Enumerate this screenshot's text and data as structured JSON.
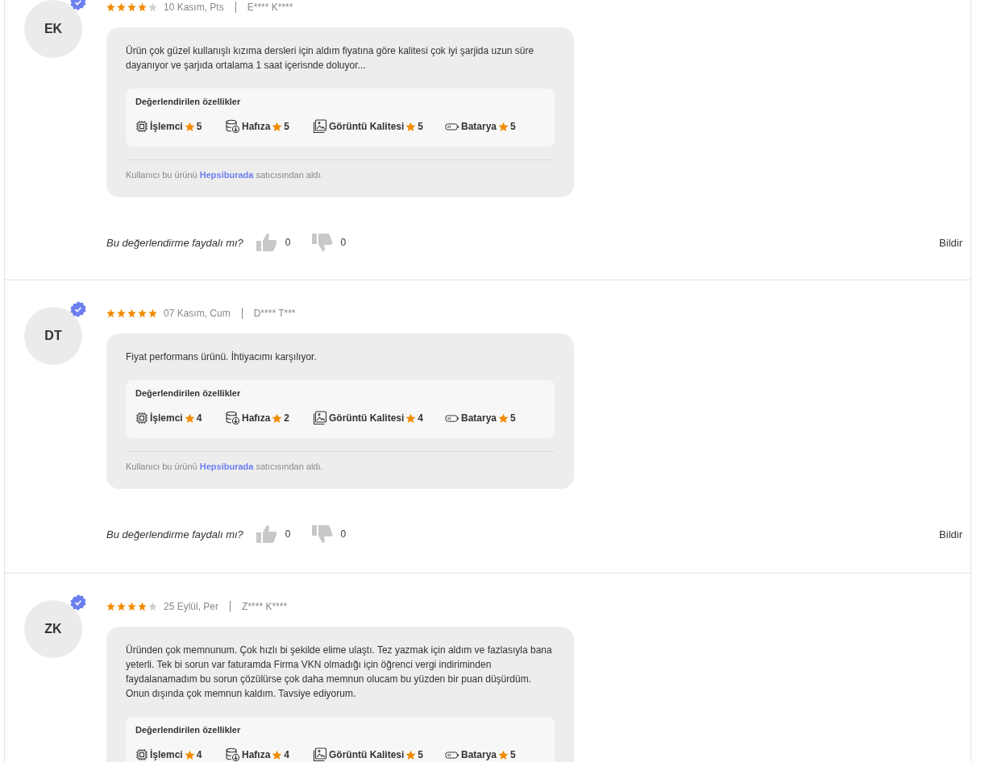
{
  "reviews": [
    {
      "initials": "EK",
      "verified": true,
      "stars": 4,
      "date": "10 Kasım, Pts",
      "author": "E**** K****",
      "text": "Ürün çok güzel kullanışlı kızıma dersleri için aldım fiyatına göre kalitesi çok iyi şarjida uzun süre dayanıyor ve şarjıda ortalama 1 saat içerisnde doluyor...",
      "features_title": "Değerlendirilen özellikler",
      "features": [
        {
          "kind": "processor",
          "name": "İşlemci",
          "rating": "5"
        },
        {
          "kind": "memory",
          "name": "Hafıza",
          "rating": "5"
        },
        {
          "kind": "image",
          "name": "Görüntü Kalitesi",
          "rating": "5"
        },
        {
          "kind": "battery",
          "name": "Batarya",
          "rating": "5"
        }
      ],
      "seller_note": {
        "before": "Kullanıcı bu ürünü",
        "seller": "Hepsiburada",
        "after": "satıcısından aldı."
      },
      "helpful": {
        "question": "Bu değerlendirme faydalı mı?",
        "up_count": "0",
        "down_count": "0",
        "report": "Bildir"
      }
    },
    {
      "initials": "DT",
      "verified": true,
      "stars": 5,
      "date": "07 Kasım, Cum",
      "author": "D**** T***",
      "text": "Fiyat performans ürünü. İhtiyacımı karşılıyor.",
      "features_title": "Değerlendirilen özellikler",
      "features": [
        {
          "kind": "processor",
          "name": "İşlemci",
          "rating": "4"
        },
        {
          "kind": "memory",
          "name": "Hafıza",
          "rating": "2"
        },
        {
          "kind": "image",
          "name": "Görüntü Kalitesi",
          "rating": "4"
        },
        {
          "kind": "battery",
          "name": "Batarya",
          "rating": "5"
        }
      ],
      "seller_note": {
        "before": "Kullanıcı bu ürünü",
        "seller": "Hepsiburada",
        "after": "satıcısından aldı."
      },
      "helpful": {
        "question": "Bu değerlendirme faydalı mı?",
        "up_count": "0",
        "down_count": "0",
        "report": "Bildir"
      }
    },
    {
      "initials": "ZK",
      "verified": true,
      "stars": 4,
      "date": "25 Eylül, Per",
      "author": "Z**** K****",
      "text": "Üründen çok memnunum. Çok hızlı bi şekilde elime ulaştı. Tez yazmak için aldım ve fazlasıyla bana yeterli. Tek bi sorun var faturamda Firma VKN olmadığı için öğrenci vergi indiriminden faydalanamadım bu sorun çözülürse çok daha memnun olucam bu yüzden bir puan düşürdüm. Onun dışında çok memnun kaldım. Tavsiye ediyorum.",
      "features_title": "Değerlendirilen özellikler",
      "features": [
        {
          "kind": "processor",
          "name": "İşlemci",
          "rating": "4"
        },
        {
          "kind": "memory",
          "name": "Hafıza",
          "rating": "4"
        },
        {
          "kind": "image",
          "name": "Görüntü Kalitesi",
          "rating": "5"
        },
        {
          "kind": "battery",
          "name": "Batarya",
          "rating": "5"
        }
      ]
    }
  ]
}
